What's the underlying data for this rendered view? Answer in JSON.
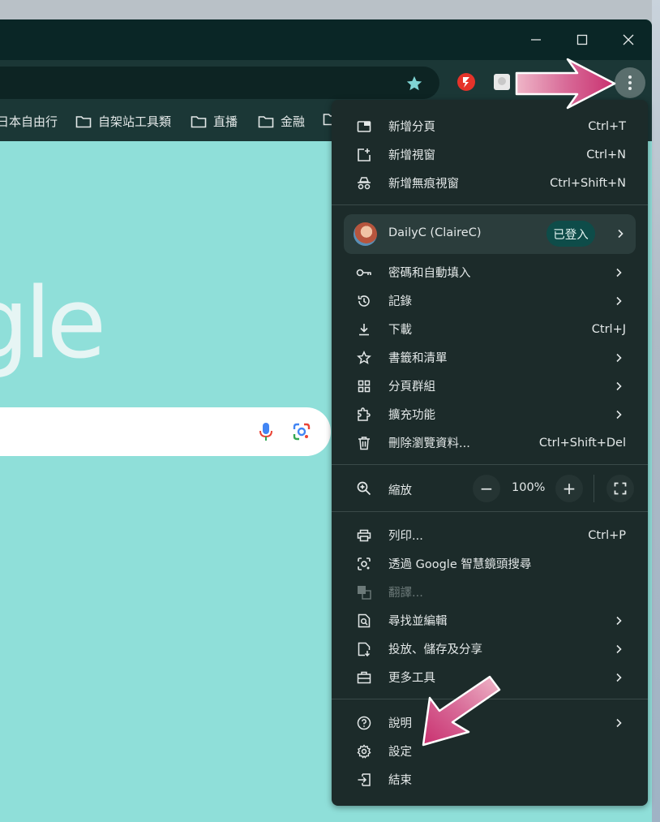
{
  "bookmarks": [
    "日本自由行",
    "自架站工具類",
    "直播",
    "金融"
  ],
  "google_logo_text": "gle",
  "menu": {
    "group1": [
      {
        "label": "新增分頁",
        "shortcut": "Ctrl+T",
        "icon": "new-tab-icon"
      },
      {
        "label": "新增視窗",
        "shortcut": "Ctrl+N",
        "icon": "new-window-icon"
      },
      {
        "label": "新增無痕視窗",
        "shortcut": "Ctrl+Shift+N",
        "icon": "incognito-icon"
      }
    ],
    "profile": {
      "name": "DailyC (ClaireC)",
      "badge": "已登入"
    },
    "group2": [
      {
        "label": "密碼和自動填入",
        "shortcut": "",
        "icon": "key-icon",
        "submenu": true
      },
      {
        "label": "記錄",
        "shortcut": "",
        "icon": "history-icon",
        "submenu": true
      },
      {
        "label": "下載",
        "shortcut": "Ctrl+J",
        "icon": "download-icon",
        "submenu": false
      },
      {
        "label": "書籤和清單",
        "shortcut": "",
        "icon": "star-outline-icon",
        "submenu": true
      },
      {
        "label": "分頁群組",
        "shortcut": "",
        "icon": "grid-icon",
        "submenu": true
      },
      {
        "label": "擴充功能",
        "shortcut": "",
        "icon": "extension-icon",
        "submenu": true
      },
      {
        "label": "刪除瀏覽資料...",
        "shortcut": "Ctrl+Shift+Del",
        "icon": "trash-icon",
        "submenu": false
      }
    ],
    "zoom": {
      "label": "縮放",
      "value": "100%",
      "minus": "−",
      "plus": "+"
    },
    "group3": [
      {
        "label": "列印...",
        "shortcut": "Ctrl+P",
        "icon": "print-icon",
        "submenu": false,
        "disabled": false
      },
      {
        "label": "透過 Google 智慧鏡頭搜尋",
        "shortcut": "",
        "icon": "lens-search-icon",
        "submenu": false,
        "disabled": false
      },
      {
        "label": "翻譯...",
        "shortcut": "",
        "icon": "translate-icon",
        "submenu": false,
        "disabled": true
      },
      {
        "label": "尋找並編輯",
        "shortcut": "",
        "icon": "find-icon",
        "submenu": true,
        "disabled": false
      },
      {
        "label": "投放、儲存及分享",
        "shortcut": "",
        "icon": "cast-save-icon",
        "submenu": true,
        "disabled": false
      },
      {
        "label": "更多工具",
        "shortcut": "",
        "icon": "toolbox-icon",
        "submenu": true,
        "disabled": false
      }
    ],
    "group4": [
      {
        "label": "說明",
        "shortcut": "",
        "icon": "help-icon",
        "submenu": true
      },
      {
        "label": "設定",
        "shortcut": "",
        "icon": "settings-gear-icon",
        "submenu": false
      },
      {
        "label": "結束",
        "shortcut": "",
        "icon": "exit-icon",
        "submenu": false
      }
    ]
  },
  "colors": {
    "page_bg": "#8fdfd9",
    "menu_bg": "#1c2b2a",
    "toolbar_bg": "#1b3736",
    "arrow": "#d2457e",
    "badge_bg": "#0e4c49"
  }
}
